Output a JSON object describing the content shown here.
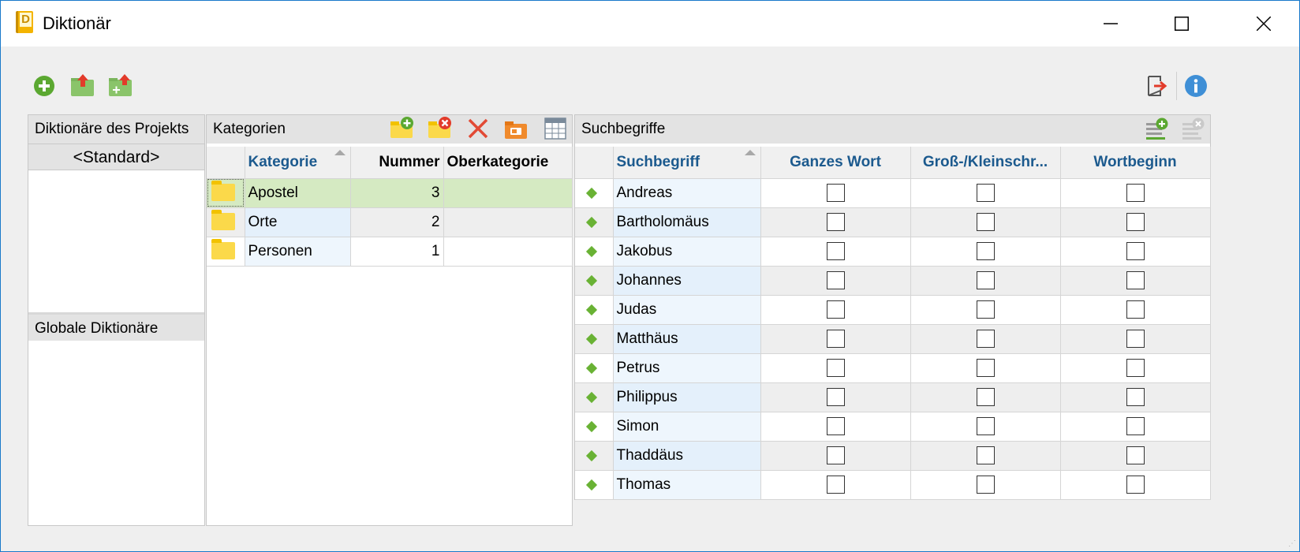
{
  "window": {
    "title": "Diktionär",
    "app_icon_letter": "D"
  },
  "toolbar": {
    "icons": [
      "add-dictionary-icon",
      "export-dictionary-icon",
      "import-dictionary-icon",
      "exit-icon",
      "info-icon"
    ]
  },
  "left_panel": {
    "project_header": "Diktionäre des Projekts",
    "standard_item": "<Standard>",
    "global_header": "Globale Diktionäre"
  },
  "categories": {
    "header": "Kategorien",
    "columns": [
      "Kategorie",
      "Nummer",
      "Oberkategorie"
    ],
    "rows": [
      {
        "name": "Apostel",
        "number": "3",
        "parent": ""
      },
      {
        "name": "Orte",
        "number": "2",
        "parent": ""
      },
      {
        "name": "Personen",
        "number": "1",
        "parent": ""
      }
    ]
  },
  "search_terms": {
    "header": "Suchbegriffe",
    "columns": [
      "Suchbegriff",
      "Ganzes Wort",
      "Groß-/Kleinschr...",
      "Wortbeginn"
    ],
    "rows": [
      {
        "term": "Andreas",
        "whole_word": false,
        "case": false,
        "word_start": false
      },
      {
        "term": "Bartholomäus",
        "whole_word": false,
        "case": false,
        "word_start": false
      },
      {
        "term": "Jakobus",
        "whole_word": false,
        "case": false,
        "word_start": false
      },
      {
        "term": "Johannes",
        "whole_word": false,
        "case": false,
        "word_start": false
      },
      {
        "term": "Judas",
        "whole_word": false,
        "case": false,
        "word_start": false
      },
      {
        "term": "Matthäus",
        "whole_word": false,
        "case": false,
        "word_start": false
      },
      {
        "term": "Petrus",
        "whole_word": false,
        "case": false,
        "word_start": false
      },
      {
        "term": "Philippus",
        "whole_word": false,
        "case": false,
        "word_start": false
      },
      {
        "term": "Simon",
        "whole_word": false,
        "case": false,
        "word_start": false
      },
      {
        "term": "Thaddäus",
        "whole_word": false,
        "case": false,
        "word_start": false
      },
      {
        "term": "Thomas",
        "whole_word": false,
        "case": false,
        "word_start": false
      }
    ]
  },
  "colors": {
    "accent_blue": "#1c5a8e",
    "selected_row": "#d5eac2",
    "green_icon": "#69b234",
    "folder_yellow": "#fbd94a"
  }
}
